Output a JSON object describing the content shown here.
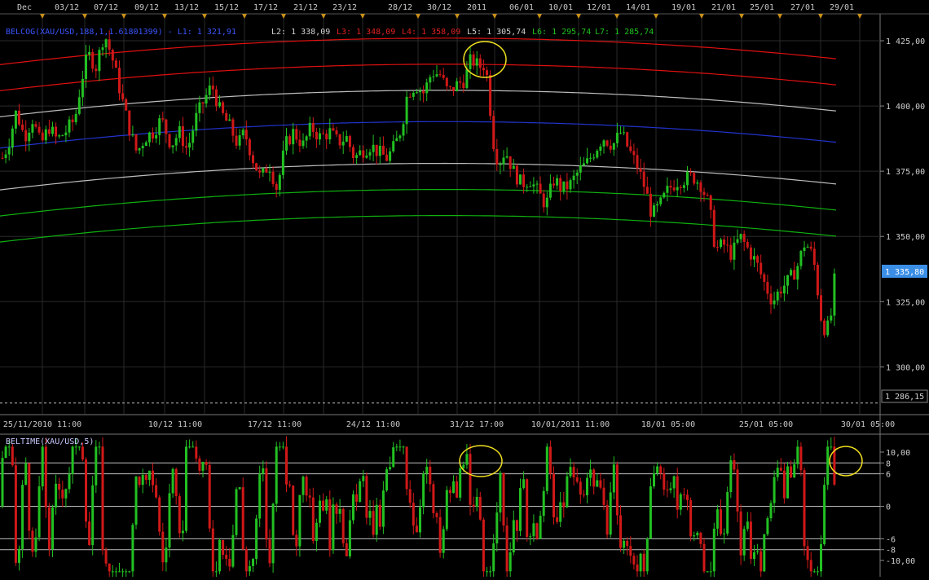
{
  "colors": {
    "background": "#000000",
    "grid": "#2a2a2a",
    "bull": "#22c022",
    "bear": "#d01818",
    "belcog_center": "#2233cc",
    "band_red": "#e01010",
    "band_white": "#bdbdbd",
    "band_green": "#10b010",
    "circle": "#f0e020",
    "price_badge": "#3a8ee6"
  },
  "top_dates": [
    "Dec",
    "03/12",
    "07/12",
    "09/12",
    "13/12",
    "15/12",
    "17/12",
    "21/12",
    "23/12",
    "28/12",
    "30/12",
    "2011",
    "06/01",
    "10/01",
    "12/01",
    "14/01",
    "19/01",
    "21/01",
    "25/01",
    "27/01",
    "29/01"
  ],
  "bottom_dates": [
    "25/11/2010 11:00",
    "10/12 11:00",
    "17/12 11:00",
    "24/12 11:00",
    "31/12 17:00",
    "10/01/2011 11:00",
    "18/01 05:00",
    "25/01 05:00",
    "30/01 05:00"
  ],
  "legend": {
    "main": "BELCOG(XAU/USD,188,1,1.61801399) - L1: 1 321,91",
    "l2": "L2: 1 338,09",
    "l3": "L3: 1 348,09",
    "l4": "L4: 1 358,09",
    "l5": "L5: 1 305,74",
    "l6": "L6: 1 295,74",
    "l7": "L7: 1 285,74"
  },
  "lower_legend": "BELTIME(XAU/USD,5)",
  "price_badge": "1 335,80",
  "dashed_level_label": "1 286,15",
  "chart_data": [
    {
      "type": "candlestick",
      "title": "BELCOG(XAU/USD,188,1,1.61801399)",
      "ylim": [
        1282,
        1435
      ],
      "yticks": [
        {
          "v": 1425,
          "label": "1 425,00"
        },
        {
          "v": 1400,
          "label": "1 400,00"
        },
        {
          "v": 1375,
          "label": "1 375,00"
        },
        {
          "v": 1350,
          "label": "1 350,00"
        },
        {
          "v": 1325,
          "label": "1 325,00"
        },
        {
          "v": 1300,
          "label": "1 300,00"
        }
      ],
      "last_close": 1335.8,
      "dashed_level": 1286.15,
      "band_levels": {
        "L1": 1321.91,
        "L2": 1338.09,
        "L3": 1348.09,
        "L4": 1358.09,
        "L5": 1305.74,
        "L6": 1295.74,
        "L7": 1285.74
      },
      "path": [
        [
          0,
          1378
        ],
        [
          10,
          1385
        ],
        [
          20,
          1398
        ],
        [
          30,
          1388
        ],
        [
          40,
          1395
        ],
        [
          50,
          1385
        ],
        [
          60,
          1392
        ],
        [
          70,
          1387
        ],
        [
          80,
          1390
        ],
        [
          92,
          1395
        ],
        [
          100,
          1410
        ],
        [
          108,
          1420
        ],
        [
          118,
          1415
        ],
        [
          128,
          1428
        ],
        [
          138,
          1418
        ],
        [
          148,
          1405
        ],
        [
          158,
          1392
        ],
        [
          168,
          1382
        ],
        [
          178,
          1388
        ],
        [
          188,
          1390
        ],
        [
          198,
          1395
        ],
        [
          210,
          1385
        ],
        [
          220,
          1390
        ],
        [
          230,
          1383
        ],
        [
          240,
          1395
        ],
        [
          250,
          1402
        ],
        [
          260,
          1408
        ],
        [
          270,
          1398
        ],
        [
          282,
          1392
        ],
        [
          292,
          1385
        ],
        [
          300,
          1390
        ],
        [
          310,
          1380
        ],
        [
          320,
          1372
        ],
        [
          330,
          1378
        ],
        [
          340,
          1368
        ],
        [
          350,
          1385
        ],
        [
          360,
          1390
        ],
        [
          372,
          1385
        ],
        [
          382,
          1392
        ],
        [
          392,
          1388
        ],
        [
          405,
          1390
        ],
        [
          415,
          1386
        ],
        [
          425,
          1388
        ],
        [
          435,
          1380
        ],
        [
          445,
          1383
        ],
        [
          455,
          1385
        ],
        [
          465,
          1382
        ],
        [
          475,
          1380
        ],
        [
          485,
          1385
        ],
        [
          493,
          1392
        ],
        [
          500,
          1405
        ],
        [
          510,
          1408
        ],
        [
          520,
          1405
        ],
        [
          530,
          1413
        ],
        [
          540,
          1412
        ],
        [
          550,
          1405
        ],
        [
          560,
          1408
        ],
        [
          570,
          1410
        ],
        [
          578,
          1418
        ],
        [
          588,
          1415
        ],
        [
          596,
          1416
        ],
        [
          606,
          1385
        ],
        [
          612,
          1378
        ],
        [
          620,
          1383
        ],
        [
          630,
          1375
        ],
        [
          640,
          1370
        ],
        [
          650,
          1372
        ],
        [
          660,
          1367
        ],
        [
          670,
          1362
        ],
        [
          680,
          1372
        ],
        [
          690,
          1368
        ],
        [
          700,
          1370
        ],
        [
          710,
          1375
        ],
        [
          720,
          1378
        ],
        [
          730,
          1383
        ],
        [
          740,
          1388
        ],
        [
          752,
          1385
        ],
        [
          762,
          1390
        ],
        [
          772,
          1383
        ],
        [
          782,
          1377
        ],
        [
          792,
          1368
        ],
        [
          800,
          1358
        ],
        [
          810,
          1362
        ],
        [
          820,
          1368
        ],
        [
          830,
          1371
        ],
        [
          840,
          1372
        ],
        [
          850,
          1373
        ],
        [
          860,
          1370
        ],
        [
          870,
          1362
        ],
        [
          878,
          1345
        ],
        [
          888,
          1347
        ],
        [
          898,
          1343
        ],
        [
          908,
          1350
        ],
        [
          918,
          1345
        ],
        [
          928,
          1340
        ],
        [
          938,
          1332
        ],
        [
          948,
          1325
        ],
        [
          958,
          1330
        ],
        [
          968,
          1333
        ],
        [
          978,
          1338
        ],
        [
          988,
          1348
        ],
        [
          998,
          1342
        ],
        [
          1008,
          1318
        ],
        [
          1014,
          1313
        ],
        [
          1020,
          1320
        ],
        [
          1027,
          1335.8
        ]
      ]
    },
    {
      "type": "bar",
      "title": "BELTIME(XAU/USD,5)",
      "ylim": [
        -13,
        13
      ],
      "yticks": [
        {
          "v": 10,
          "label": "10,00"
        },
        {
          "v": 8,
          "label": "8"
        },
        {
          "v": 6,
          "label": "6"
        },
        {
          "v": 0,
          "label": "0"
        },
        {
          "v": -6,
          "label": "-6"
        },
        {
          "v": -8,
          "label": "-8"
        },
        {
          "v": -10,
          "label": "-10,00"
        }
      ],
      "hlines": [
        8,
        6,
        0,
        -6,
        -8
      ]
    }
  ]
}
